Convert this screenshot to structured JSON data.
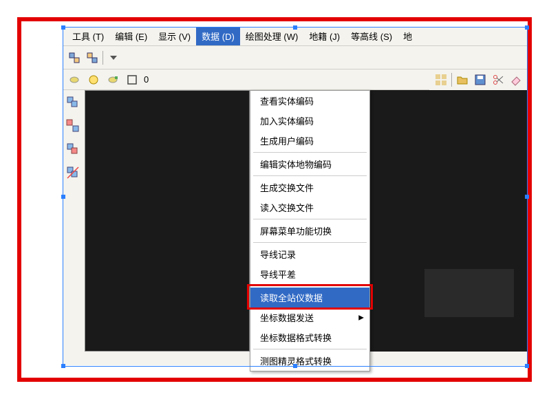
{
  "menubar": {
    "items": [
      {
        "label": "工具 (T)"
      },
      {
        "label": "编辑 (E)"
      },
      {
        "label": "显示 (V)"
      },
      {
        "label": "数据 (D)"
      },
      {
        "label": "绘图处理 (W)"
      },
      {
        "label": "地籍 (J)"
      },
      {
        "label": "等高线 (S)"
      },
      {
        "label": "地"
      }
    ],
    "active_index": 3
  },
  "toolbar2": {
    "count_label": "0"
  },
  "dropdown": {
    "groups": [
      [
        {
          "label": "查看实体编码"
        },
        {
          "label": "加入实体编码"
        },
        {
          "label": "生成用户编码"
        }
      ],
      [
        {
          "label": "编辑实体地物编码"
        }
      ],
      [
        {
          "label": "生成交换文件"
        },
        {
          "label": "读入交换文件"
        }
      ],
      [
        {
          "label": "屏幕菜单功能切换"
        }
      ],
      [
        {
          "label": "导线记录"
        },
        {
          "label": "导线平差"
        }
      ],
      [
        {
          "label": "读取全站仪数据",
          "selected": true
        },
        {
          "label": "坐标数据发送",
          "submenu": true
        },
        {
          "label": "坐标数据格式转换"
        }
      ],
      [
        {
          "label": "测图精灵格式转换"
        }
      ]
    ]
  }
}
